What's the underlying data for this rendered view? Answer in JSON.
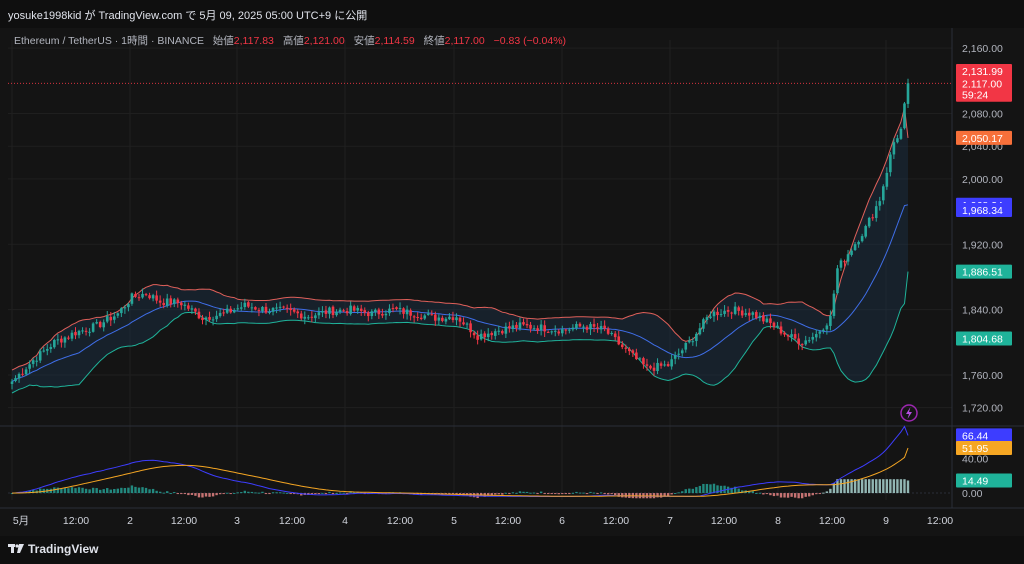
{
  "header": {
    "publish_line": "yosuke1998kid が TradingView.com で 5月 09, 2025 05:00 UTC+9 に公開"
  },
  "legend": {
    "symbol": "Ethereum / TetherUS · 1時間 · BINANCE",
    "open_label": "始値",
    "open": "2,117.83",
    "high_label": "高値",
    "high": "2,121.00",
    "low_label": "安値",
    "low": "2,114.59",
    "close_label": "終値",
    "close": "2,117.00",
    "change": "−0.83 (−0.04%)"
  },
  "footer": {
    "brand": "TradingView"
  },
  "colors": {
    "up": "#26a69a",
    "down": "#f23645",
    "bb_upper": "#e0605a",
    "bb_basis": "#3f6ee8",
    "bb_lower": "#1fb39a",
    "ema_blue": "#3d3dff",
    "ema_orange": "#f5a623"
  },
  "price_scale": {
    "ticks": [
      "2,160.00",
      "2,080.00",
      "2,040.00",
      "2,000.00",
      "1,920.00",
      "1,840.00",
      "1,760.00",
      "1,720.00"
    ],
    "tick_values": [
      2160,
      2080,
      2040,
      2000,
      1920,
      1840,
      1760,
      1720
    ],
    "badges": [
      {
        "text": "2,131.99",
        "value": 2131.99,
        "color": "#f23645"
      },
      {
        "text": "2,117.00",
        "value": 2117.0,
        "color": "#f23645"
      },
      {
        "text": "59:24",
        "value": 2103.0,
        "color": "#f23645"
      },
      {
        "text": "2,050.17",
        "value": 2050.17,
        "color": "#f7703a"
      },
      {
        "text": "1,968.34",
        "value": 1968.34,
        "color": "#3d3dff"
      },
      {
        "text": "1,968.34",
        "value": 1962.0,
        "color": "#3d3dff"
      },
      {
        "text": "1,886.51",
        "value": 1886.51,
        "color": "#1fb39a"
      },
      {
        "text": "1,804.68",
        "value": 1804.68,
        "color": "#1fb39a"
      }
    ]
  },
  "osc_scale": {
    "ticks": [
      "40.00",
      "0.00"
    ],
    "tick_values": [
      40,
      0
    ],
    "badges": [
      {
        "text": "66.44",
        "value": 66.44,
        "color": "#3d3dff"
      },
      {
        "text": "51.95",
        "value": 51.95,
        "color": "#f5a623"
      },
      {
        "text": "14.49",
        "value": 14.49,
        "color": "#1fb39a"
      }
    ]
  },
  "time_axis": {
    "labels": [
      "5月",
      "12:00",
      "2",
      "12:00",
      "3",
      "12:00",
      "4",
      "12:00",
      "5",
      "12:00",
      "6",
      "12:00",
      "7",
      "12:00",
      "8",
      "12:00",
      "9",
      "12:00"
    ]
  },
  "chart_data": {
    "type": "candlestick",
    "title": "Ethereum / TetherUS · 1時間 · BINANCE",
    "timeframe": "1h",
    "x_range": [
      "5月 1 00:00",
      "5月 9 05:00"
    ],
    "ylim": [
      1700,
      2170
    ],
    "close_anchors": [
      [
        0,
        1752
      ],
      [
        6,
        1778
      ],
      [
        12,
        1800
      ],
      [
        18,
        1812
      ],
      [
        24,
        1820
      ],
      [
        30,
        1835
      ],
      [
        34,
        1855
      ],
      [
        38,
        1860
      ],
      [
        42,
        1850
      ],
      [
        48,
        1848
      ],
      [
        54,
        1830
      ],
      [
        60,
        1835
      ],
      [
        66,
        1845
      ],
      [
        72,
        1840
      ],
      [
        78,
        1838
      ],
      [
        84,
        1832
      ],
      [
        90,
        1838
      ],
      [
        96,
        1840
      ],
      [
        102,
        1835
      ],
      [
        108,
        1840
      ],
      [
        114,
        1835
      ],
      [
        120,
        1830
      ],
      [
        126,
        1832
      ],
      [
        132,
        1808
      ],
      [
        138,
        1815
      ],
      [
        144,
        1820
      ],
      [
        150,
        1818
      ],
      [
        156,
        1815
      ],
      [
        162,
        1820
      ],
      [
        168,
        1815
      ],
      [
        174,
        1790
      ],
      [
        180,
        1768
      ],
      [
        186,
        1772
      ],
      [
        192,
        1800
      ],
      [
        198,
        1835
      ],
      [
        204,
        1840
      ],
      [
        210,
        1835
      ],
      [
        216,
        1820
      ],
      [
        220,
        1808
      ],
      [
        224,
        1800
      ],
      [
        228,
        1810
      ],
      [
        232,
        1830
      ],
      [
        234,
        1890
      ],
      [
        238,
        1915
      ],
      [
        242,
        1940
      ],
      [
        246,
        1975
      ],
      [
        248,
        2010
      ],
      [
        250,
        2045
      ],
      [
        252,
        2060
      ],
      [
        254,
        2117
      ]
    ],
    "bollinger_last": {
      "upper": 2050.17,
      "basis": 1968.34,
      "lower": 1886.51
    },
    "oscillator": {
      "ylim": [
        -8,
        75
      ],
      "last": {
        "line_blue": 66.44,
        "line_orange": 51.95,
        "histogram": 14.49
      }
    }
  }
}
